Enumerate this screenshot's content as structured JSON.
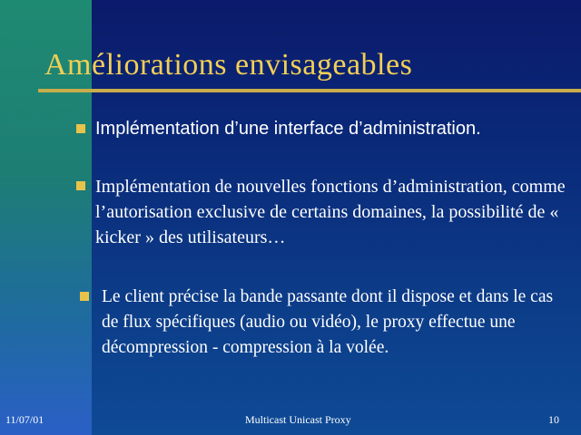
{
  "slide": {
    "title": "Améliorations envisageables",
    "bullets": [
      {
        "text": "Implémentation d’une interface d’administration."
      },
      {
        "text": "Implémentation de nouvelles fonctions d’administration, comme l’autorisation exclusive de certains domaines, la possibilité de « kicker » des utilisateurs…"
      },
      {
        "text": "Le client précise la bande passante dont il dispose et dans le cas de flux spécifiques (audio ou vidéo), le proxy effectue une décompression - compression à la volée."
      }
    ],
    "footer": {
      "date": "11/07/01",
      "title": "Multicast Unicast Proxy",
      "page": "10"
    }
  },
  "colors": {
    "title": "#f2cf55",
    "bullet_marker": "#e8c34a",
    "title_rule": "#c8ad4a",
    "background": "#0a2a7a",
    "left_strip": "#1d7e74",
    "text": "#ffffff"
  },
  "icons": {
    "bullet": "square-bullet-icon"
  }
}
